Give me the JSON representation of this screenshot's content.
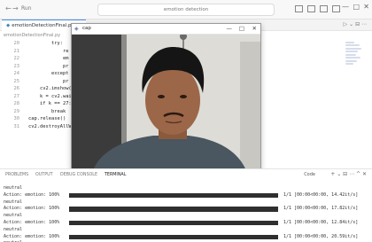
{
  "titlebar": {
    "back": "←",
    "forward": "→",
    "run_label": "Run",
    "search": "emotion detection",
    "minimize": "—",
    "maximize": "□",
    "close": "✕"
  },
  "editor": {
    "tab": {
      "label": "emotionDetectionFinal.py",
      "close": "×"
    },
    "tab_actions": "▷ ⌄ ⊟ ⋯",
    "breadcrumb": "emotionDetectionFinal.py",
    "lines": [
      {
        "num": "20",
        "code": "        try:"
      },
      {
        "num": "21",
        "code": "            re"
      },
      {
        "num": "22",
        "code": "            em"
      },
      {
        "num": "23",
        "code": "            pr"
      },
      {
        "num": "24",
        "code": "        except"
      },
      {
        "num": "25",
        "code": "            pr"
      },
      {
        "num": "26",
        "code": "    cv2.imshow("
      },
      {
        "num": "27",
        "code": "    k = cv2.wait"
      },
      {
        "num": "28",
        "code": "    if k == 27:"
      },
      {
        "num": "29",
        "code": "        break"
      },
      {
        "num": "30",
        "code": "cap.release()"
      },
      {
        "num": "31",
        "code": "cv2.destroyAllWi"
      }
    ]
  },
  "camera_window": {
    "title": "cap",
    "minimize": "—",
    "maximize": "□",
    "close": "✕"
  },
  "panel": {
    "tabs": [
      "PROBLEMS",
      "OUTPUT",
      "DEBUG CONSOLE",
      "TERMINAL"
    ],
    "code_label": "Code",
    "actions": "+ ⌄ ⊟ ⋯ ^ ✕",
    "terminal": [
      {
        "text": "neutral"
      },
      {
        "text": "Action: emotion: 100%",
        "bar": true,
        "stat": "1/1 [00:00<00:00, 14.42it/s]"
      },
      {
        "text": "neutral"
      },
      {
        "text": "Action: emotion: 100%",
        "bar": true,
        "stat": "1/1 [00:00<00:00, 17.82it/s]"
      },
      {
        "text": "neutral"
      },
      {
        "text": "Action: emotion: 100%",
        "bar": true,
        "stat": "1/1 [00:00<00:00, 12.84it/s]"
      },
      {
        "text": "neutral"
      },
      {
        "text": "Action: emotion: 100%",
        "bar": true,
        "stat": "1/1 [00:00<00:00, 20.59it/s]"
      },
      {
        "text": "neutral"
      }
    ]
  }
}
